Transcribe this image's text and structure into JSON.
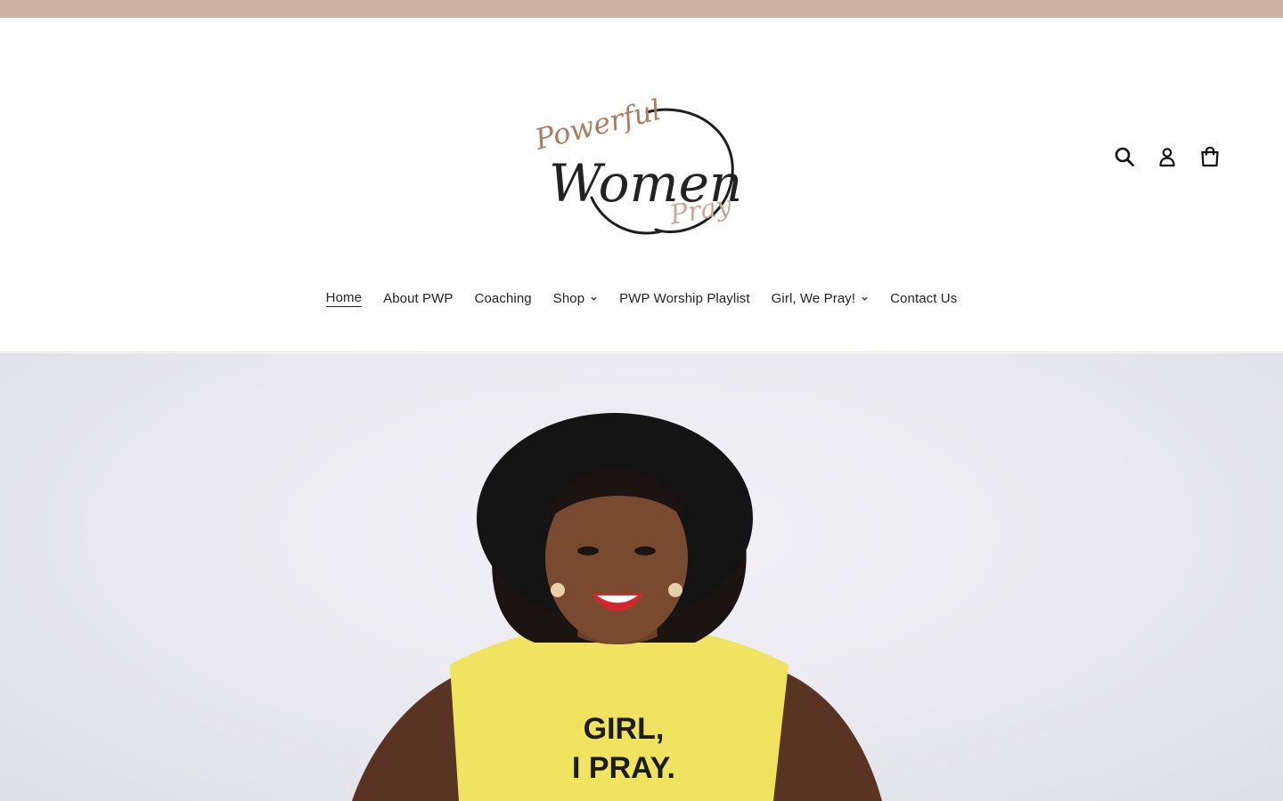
{
  "brand": {
    "logo_word_1": "Powerful",
    "logo_word_2": "Women",
    "logo_word_3": "Pray",
    "accent_color": "#cdb1a2",
    "logo_script_color": "#a97d62"
  },
  "header_icons": [
    {
      "icon": "search-icon"
    },
    {
      "icon": "account-icon"
    },
    {
      "icon": "cart-icon"
    }
  ],
  "nav": {
    "items": [
      {
        "label": "Home",
        "active": true,
        "dropdown": false
      },
      {
        "label": "About PWP",
        "active": false,
        "dropdown": false
      },
      {
        "label": "Coaching",
        "active": false,
        "dropdown": false
      },
      {
        "label": "Shop",
        "active": false,
        "dropdown": true
      },
      {
        "label": "PWP Worship Playlist",
        "active": false,
        "dropdown": false
      },
      {
        "label": "Girl, We Pray!",
        "active": false,
        "dropdown": true
      },
      {
        "label": "Contact Us",
        "active": false,
        "dropdown": false
      }
    ]
  },
  "hero": {
    "shirt_line_1": "GIRL,",
    "shirt_line_2": "I PRAY.",
    "shirt_color": "#f0e35f",
    "hat_color": "#141414"
  }
}
